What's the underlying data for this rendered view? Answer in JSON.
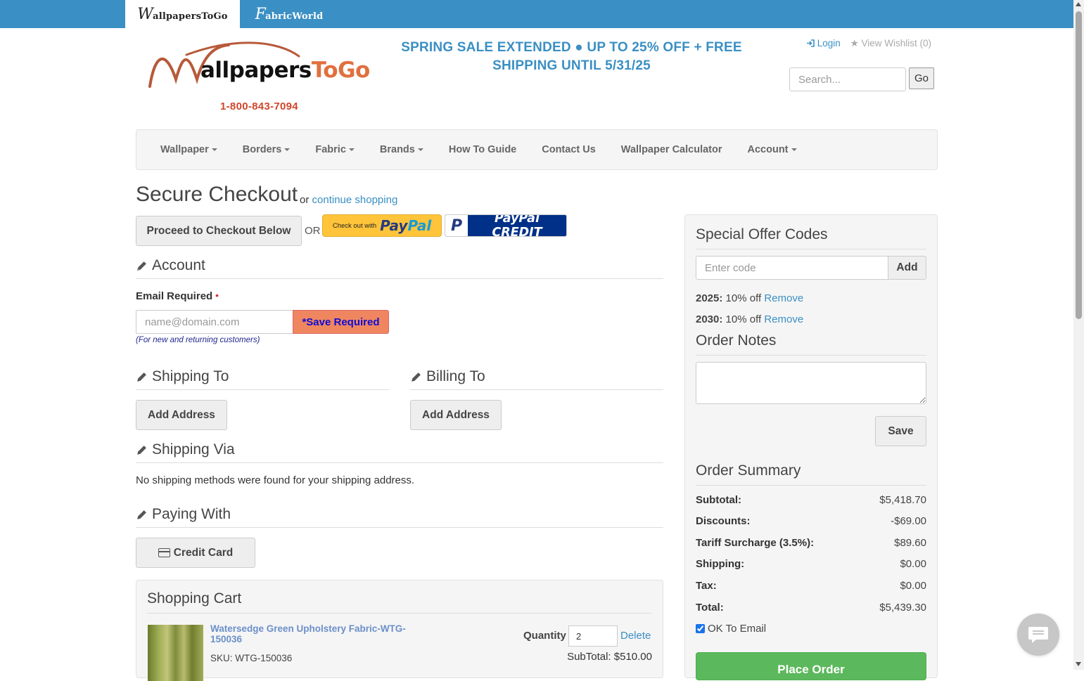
{
  "site_tabs": {
    "wallpaper": {
      "initial": "W",
      "rest": "allpapersToGo"
    },
    "fabric": {
      "initial": "F",
      "rest": "abricWorld"
    }
  },
  "header": {
    "logo_initial": "W",
    "logo_main": "allpapers",
    "logo_accent": "ToGo",
    "phone": "1-800-843-7094",
    "promo_line1": "SPRING SALE EXTENDED ● UP TO 25% OFF + FREE",
    "promo_line2": "SHIPPING UNTIL 5/31/25",
    "login": "Login",
    "wishlist": "View Wishlist (0)",
    "search_placeholder": "Search...",
    "go_label": "Go"
  },
  "nav": {
    "items": [
      {
        "label": "Wallpaper",
        "dropdown": true
      },
      {
        "label": "Borders",
        "dropdown": true
      },
      {
        "label": "Fabric",
        "dropdown": true
      },
      {
        "label": "Brands",
        "dropdown": true
      },
      {
        "label": "How To Guide",
        "dropdown": false
      },
      {
        "label": "Contact Us",
        "dropdown": false
      },
      {
        "label": "Wallpaper Calculator",
        "dropdown": false
      },
      {
        "label": "Account",
        "dropdown": true
      }
    ]
  },
  "checkout": {
    "title": "Secure Checkout",
    "or_text": "or",
    "continue_link": "continue shopping",
    "proceed_button": "Proceed to Checkout Below",
    "or_label": "OR",
    "paypal_small": "Check out with",
    "paypal_pay": "Pay",
    "paypal_pal": "Pal",
    "paypal_credit_icon": "P",
    "paypal_credit": "PayPal CREDIT"
  },
  "account": {
    "heading": "Account",
    "email_label": "Email Required",
    "required_mark": "*",
    "email_placeholder": "name@domain.com",
    "save_required": "*Save Required",
    "email_help": "(For new and returning customers)"
  },
  "shipping_to": {
    "heading": "Shipping To",
    "button": "Add Address"
  },
  "billing_to": {
    "heading": "Billing To",
    "button": "Add Address"
  },
  "shipping_via": {
    "heading": "Shipping Via",
    "message": "No shipping methods were found for your shipping address."
  },
  "paying_with": {
    "heading": "Paying With",
    "button": "Credit Card"
  },
  "cart": {
    "heading": "Shopping Cart",
    "item": {
      "name": "Watersedge Green Upholstery Fabric-WTG-150036",
      "sku": "SKU: WTG-150036",
      "quantity_label": "Quantity",
      "quantity": "2",
      "delete": "Delete",
      "subtotal": "SubTotal: $510.00"
    }
  },
  "sidebar": {
    "offer_heading": "Special Offer Codes",
    "code_placeholder": "Enter code",
    "add_label": "Add",
    "codes": [
      {
        "code": "2025:",
        "desc": "10% off",
        "remove": "Remove"
      },
      {
        "code": "2030:",
        "desc": "10% off",
        "remove": "Remove"
      }
    ],
    "notes_heading": "Order Notes",
    "save_label": "Save",
    "summary_heading": "Order Summary",
    "summary": [
      {
        "label": "Subtotal:",
        "value": "$5,418.70"
      },
      {
        "label": "Discounts:",
        "value": "-$69.00"
      },
      {
        "label": "Tariff Surcharge (3.5%):",
        "value": "$89.60"
      },
      {
        "label": "Shipping:",
        "value": "$0.00"
      },
      {
        "label": "Tax:",
        "value": "$0.00"
      },
      {
        "label": "Total:",
        "value": "$5,439.30"
      }
    ],
    "ok_email": "OK To Email",
    "place_order": "Place Order"
  },
  "colors": {
    "brand_blue": "#3a8fc4",
    "phone_red": "#d0462a",
    "logo_orange": "#e0703f",
    "save_required_bg": "#f0865f",
    "place_order_green": "#5cb85c"
  }
}
